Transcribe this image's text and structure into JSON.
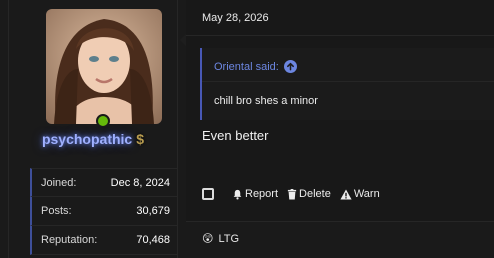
{
  "user": {
    "username": "psychopathic",
    "badge_icon": "dollar-icon",
    "badge_symbol": "$",
    "online_status_color": "#65b80b",
    "name_color": "#9fb0ff",
    "stats": [
      {
        "label": "Joined:",
        "value": "Dec 8, 2024"
      },
      {
        "label": "Posts:",
        "value": "30,679"
      },
      {
        "label": "Reputation:",
        "value": "70,468"
      }
    ]
  },
  "post": {
    "date": "May 28, 2026",
    "quote": {
      "author_line": "Oriental said:",
      "icon": "arrow-up-circle-icon",
      "text": "chill bro shes a minor"
    },
    "body": "Even better",
    "actions": {
      "report": "Report",
      "delete": "Delete",
      "warn": "Warn"
    },
    "reaction": {
      "emoji": "😲",
      "label": "LTG"
    }
  },
  "colors": {
    "accent": "#6c86e0",
    "quote_border": "#4858b6",
    "background": "#161616"
  }
}
